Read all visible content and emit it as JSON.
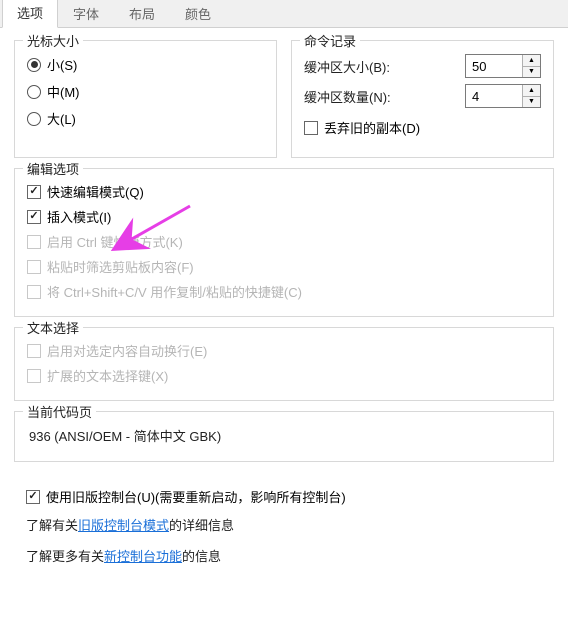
{
  "tabs": [
    {
      "label": "选项",
      "active": true
    },
    {
      "label": "字体",
      "active": false
    },
    {
      "label": "布局",
      "active": false
    },
    {
      "label": "颜色",
      "active": false
    }
  ],
  "cursor_size": {
    "legend": "光标大小",
    "options": [
      {
        "label": "小(S)",
        "checked": true
      },
      {
        "label": "中(M)",
        "checked": false
      },
      {
        "label": "大(L)",
        "checked": false
      }
    ]
  },
  "cmd_history": {
    "legend": "命令记录",
    "buffer_size_label": "缓冲区大小(B):",
    "buffer_size": "50",
    "buffer_count_label": "缓冲区数量(N):",
    "buffer_count": "4",
    "discard_label": "丢弃旧的副本(D)",
    "discard_checked": false
  },
  "edit_options": {
    "legend": "编辑选项",
    "items": [
      {
        "label": "快速编辑模式(Q)",
        "checked": true,
        "disabled": false
      },
      {
        "label": "插入模式(I)",
        "checked": true,
        "disabled": false
      },
      {
        "label": "启用 Ctrl 键快捷方式(K)",
        "checked": false,
        "disabled": true
      },
      {
        "label": "粘贴时筛选剪贴板内容(F)",
        "checked": false,
        "disabled": true
      },
      {
        "label": "将 Ctrl+Shift+C/V 用作复制/粘贴的快捷键(C)",
        "checked": false,
        "disabled": true
      }
    ]
  },
  "text_select": {
    "legend": "文本选择",
    "items": [
      {
        "label": "启用对选定内容自动换行(E)",
        "checked": false,
        "disabled": true
      },
      {
        "label": "扩展的文本选择键(X)",
        "checked": false,
        "disabled": true
      }
    ]
  },
  "codepage": {
    "legend": "当前代码页",
    "value": "936   (ANSI/OEM - 简体中文 GBK)"
  },
  "footer": {
    "legacy_checkbox_label": "使用旧版控制台(U)(需要重新启动，影响所有控制台)",
    "legacy_checked": true,
    "line1_prefix": "了解有关",
    "line1_link": "旧版控制台模式",
    "line1_suffix": "的详细信息",
    "line2_prefix": "了解更多有关",
    "line2_link": "新控制台功能",
    "line2_suffix": "的信息"
  },
  "arrow_color": "#e63ee6"
}
